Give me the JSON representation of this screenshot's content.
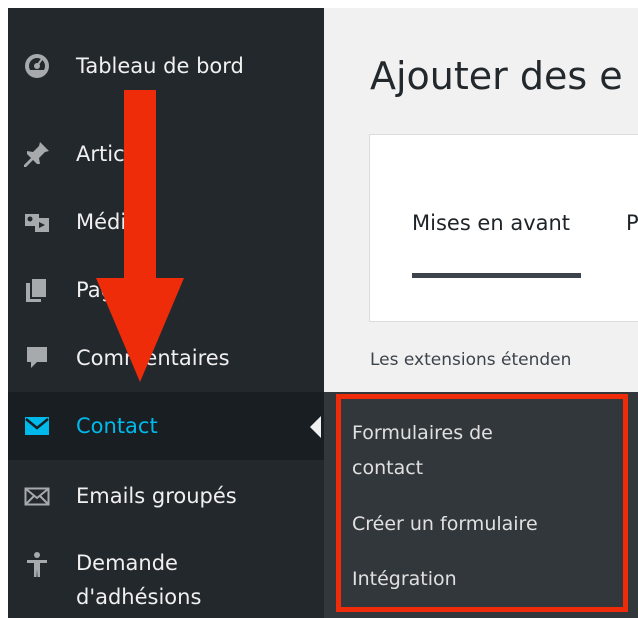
{
  "sidebar": {
    "items": [
      {
        "label": "Tableau de bord",
        "icon": "dashboard-icon"
      },
      {
        "label": "Articles",
        "icon": "pin-icon"
      },
      {
        "label": "Médias",
        "icon": "media-icon"
      },
      {
        "label": "Pages",
        "icon": "pages-icon"
      },
      {
        "label": "Commentaires",
        "icon": "comments-icon"
      },
      {
        "label": "Contact",
        "icon": "envelope-icon",
        "active": true
      },
      {
        "label": "Emails groupés",
        "icon": "email-icon"
      },
      {
        "label": "Demande d'adhésions",
        "icon": "person-icon"
      }
    ]
  },
  "main": {
    "title": "Ajouter des e",
    "tabs": [
      {
        "label": "Mises en avant",
        "active": true
      },
      {
        "label": "P"
      }
    ],
    "description": "Les extensions étenden"
  },
  "submenu": {
    "items": [
      {
        "label": "Formulaires de contact"
      },
      {
        "label": "Créer un formulaire"
      },
      {
        "label": "Intégration"
      }
    ]
  },
  "colors": {
    "sidebar_bg": "#23282d",
    "active_item_bg": "#191e23",
    "active_text": "#00b9eb",
    "submenu_bg": "#32373c",
    "annotation_red": "#ee2c0a",
    "content_bg": "#f1f1f1"
  }
}
